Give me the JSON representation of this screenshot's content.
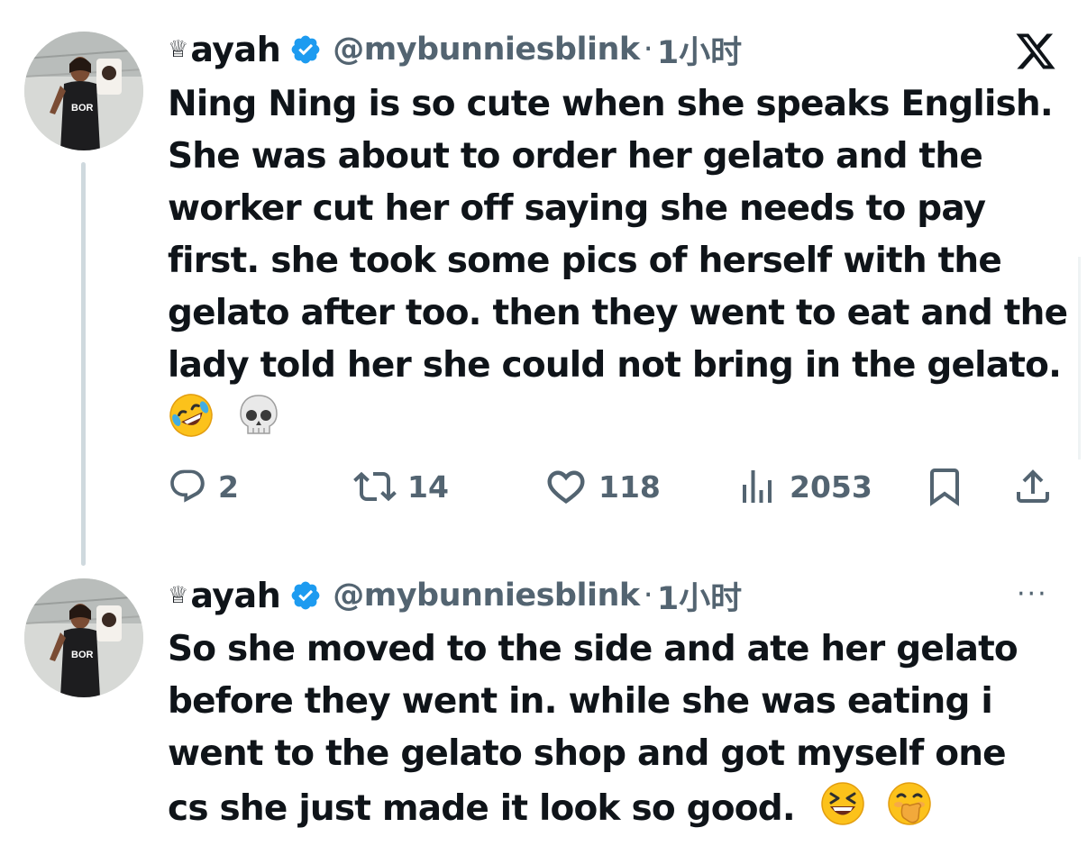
{
  "brand": {
    "logo": "x-logo-icon",
    "text_color": "#0f1419",
    "muted_color": "#536471",
    "verified_color": "#1d9bf0"
  },
  "tweets": [
    {
      "author": {
        "crown": "♕",
        "name": "ayah",
        "handle": "@mybunniesblink",
        "separator": "·",
        "time": "1小时",
        "avatar": "avatar-photo",
        "verified": true
      },
      "lines": [
        "Ning Ning is so cute when she speaks English.",
        "She was about to order her gelato and the",
        "worker cut her off saying she needs to pay",
        "first. she took some pics of herself with the",
        "gelato after too. then they went to eat and the",
        "lady told her she could not bring in the gelato."
      ],
      "emojis": [
        "rolling-on-floor-laughing",
        "skull"
      ],
      "actions": {
        "replies": "2",
        "reposts": "14",
        "likes": "118",
        "views": "2053"
      }
    },
    {
      "author": {
        "crown": "♕",
        "name": "ayah",
        "handle": "@mybunniesblink",
        "separator": "·",
        "time": "1小时",
        "avatar": "avatar-photo",
        "verified": true
      },
      "lines": [
        "So she moved to the side and ate her gelato",
        "before they went in. while she was eating i",
        "went to the gelato shop and got myself one",
        "cs she just made it look so good."
      ],
      "emojis": [
        "grinning-squinting-face",
        "face-with-hand-over-mouth"
      ],
      "more_menu": "···"
    }
  ]
}
